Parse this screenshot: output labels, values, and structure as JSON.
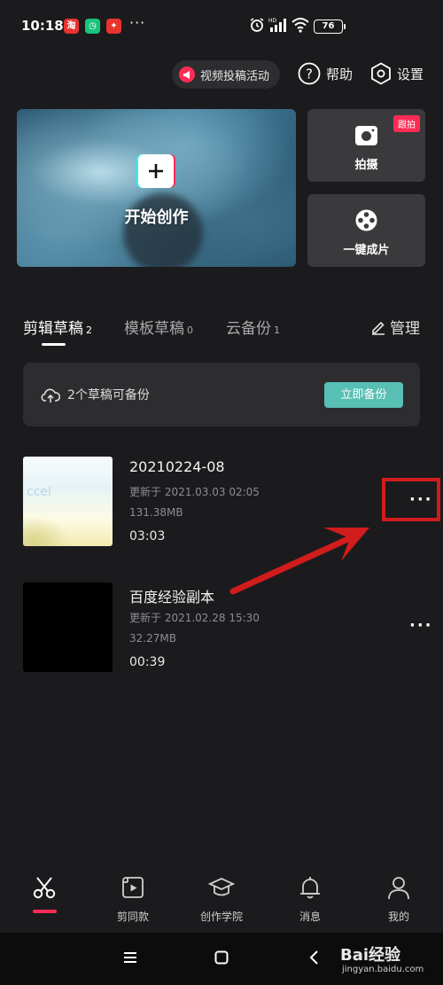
{
  "status_bar": {
    "time": "10:18",
    "more": "···",
    "battery": "76"
  },
  "top_actions": {
    "promo": "视频投稿活动",
    "help": "帮助",
    "settings": "设置"
  },
  "hero": {
    "title": "开始创作"
  },
  "side_cards": {
    "shoot": {
      "label": "拍摄",
      "badge": "跟拍"
    },
    "oneclick": {
      "label": "一键成片"
    }
  },
  "tabs": [
    {
      "label": "剪辑草稿",
      "count": "2"
    },
    {
      "label": "模板草稿",
      "count": "0"
    },
    {
      "label": "云备份",
      "count": "1"
    }
  ],
  "manage": "管理",
  "backup": {
    "text": "2个草稿可备份",
    "button": "立即备份"
  },
  "drafts": [
    {
      "title": "20210224-08",
      "updated": "更新于 2021.03.03 02:05",
      "size": "131.38MB",
      "duration": "03:03",
      "thumb_text": "ccel"
    },
    {
      "title": "百度经验副本",
      "updated": "更新于 2021.02.28 15:30",
      "size": "32.27MB",
      "duration": "00:39"
    }
  ],
  "more_label": "···",
  "bottom_nav": [
    {
      "label": ""
    },
    {
      "label": "剪同款"
    },
    {
      "label": "创作学院"
    },
    {
      "label": "消息"
    },
    {
      "label": "我的"
    }
  ],
  "watermark": {
    "brand": "Bai经验",
    "url": "jingyan.baidu.com"
  },
  "colors": {
    "background": "#1b1b1d",
    "accent_red": "#fe2c55",
    "backup_button": "#58bfb4",
    "annotation": "#d11c1c"
  }
}
